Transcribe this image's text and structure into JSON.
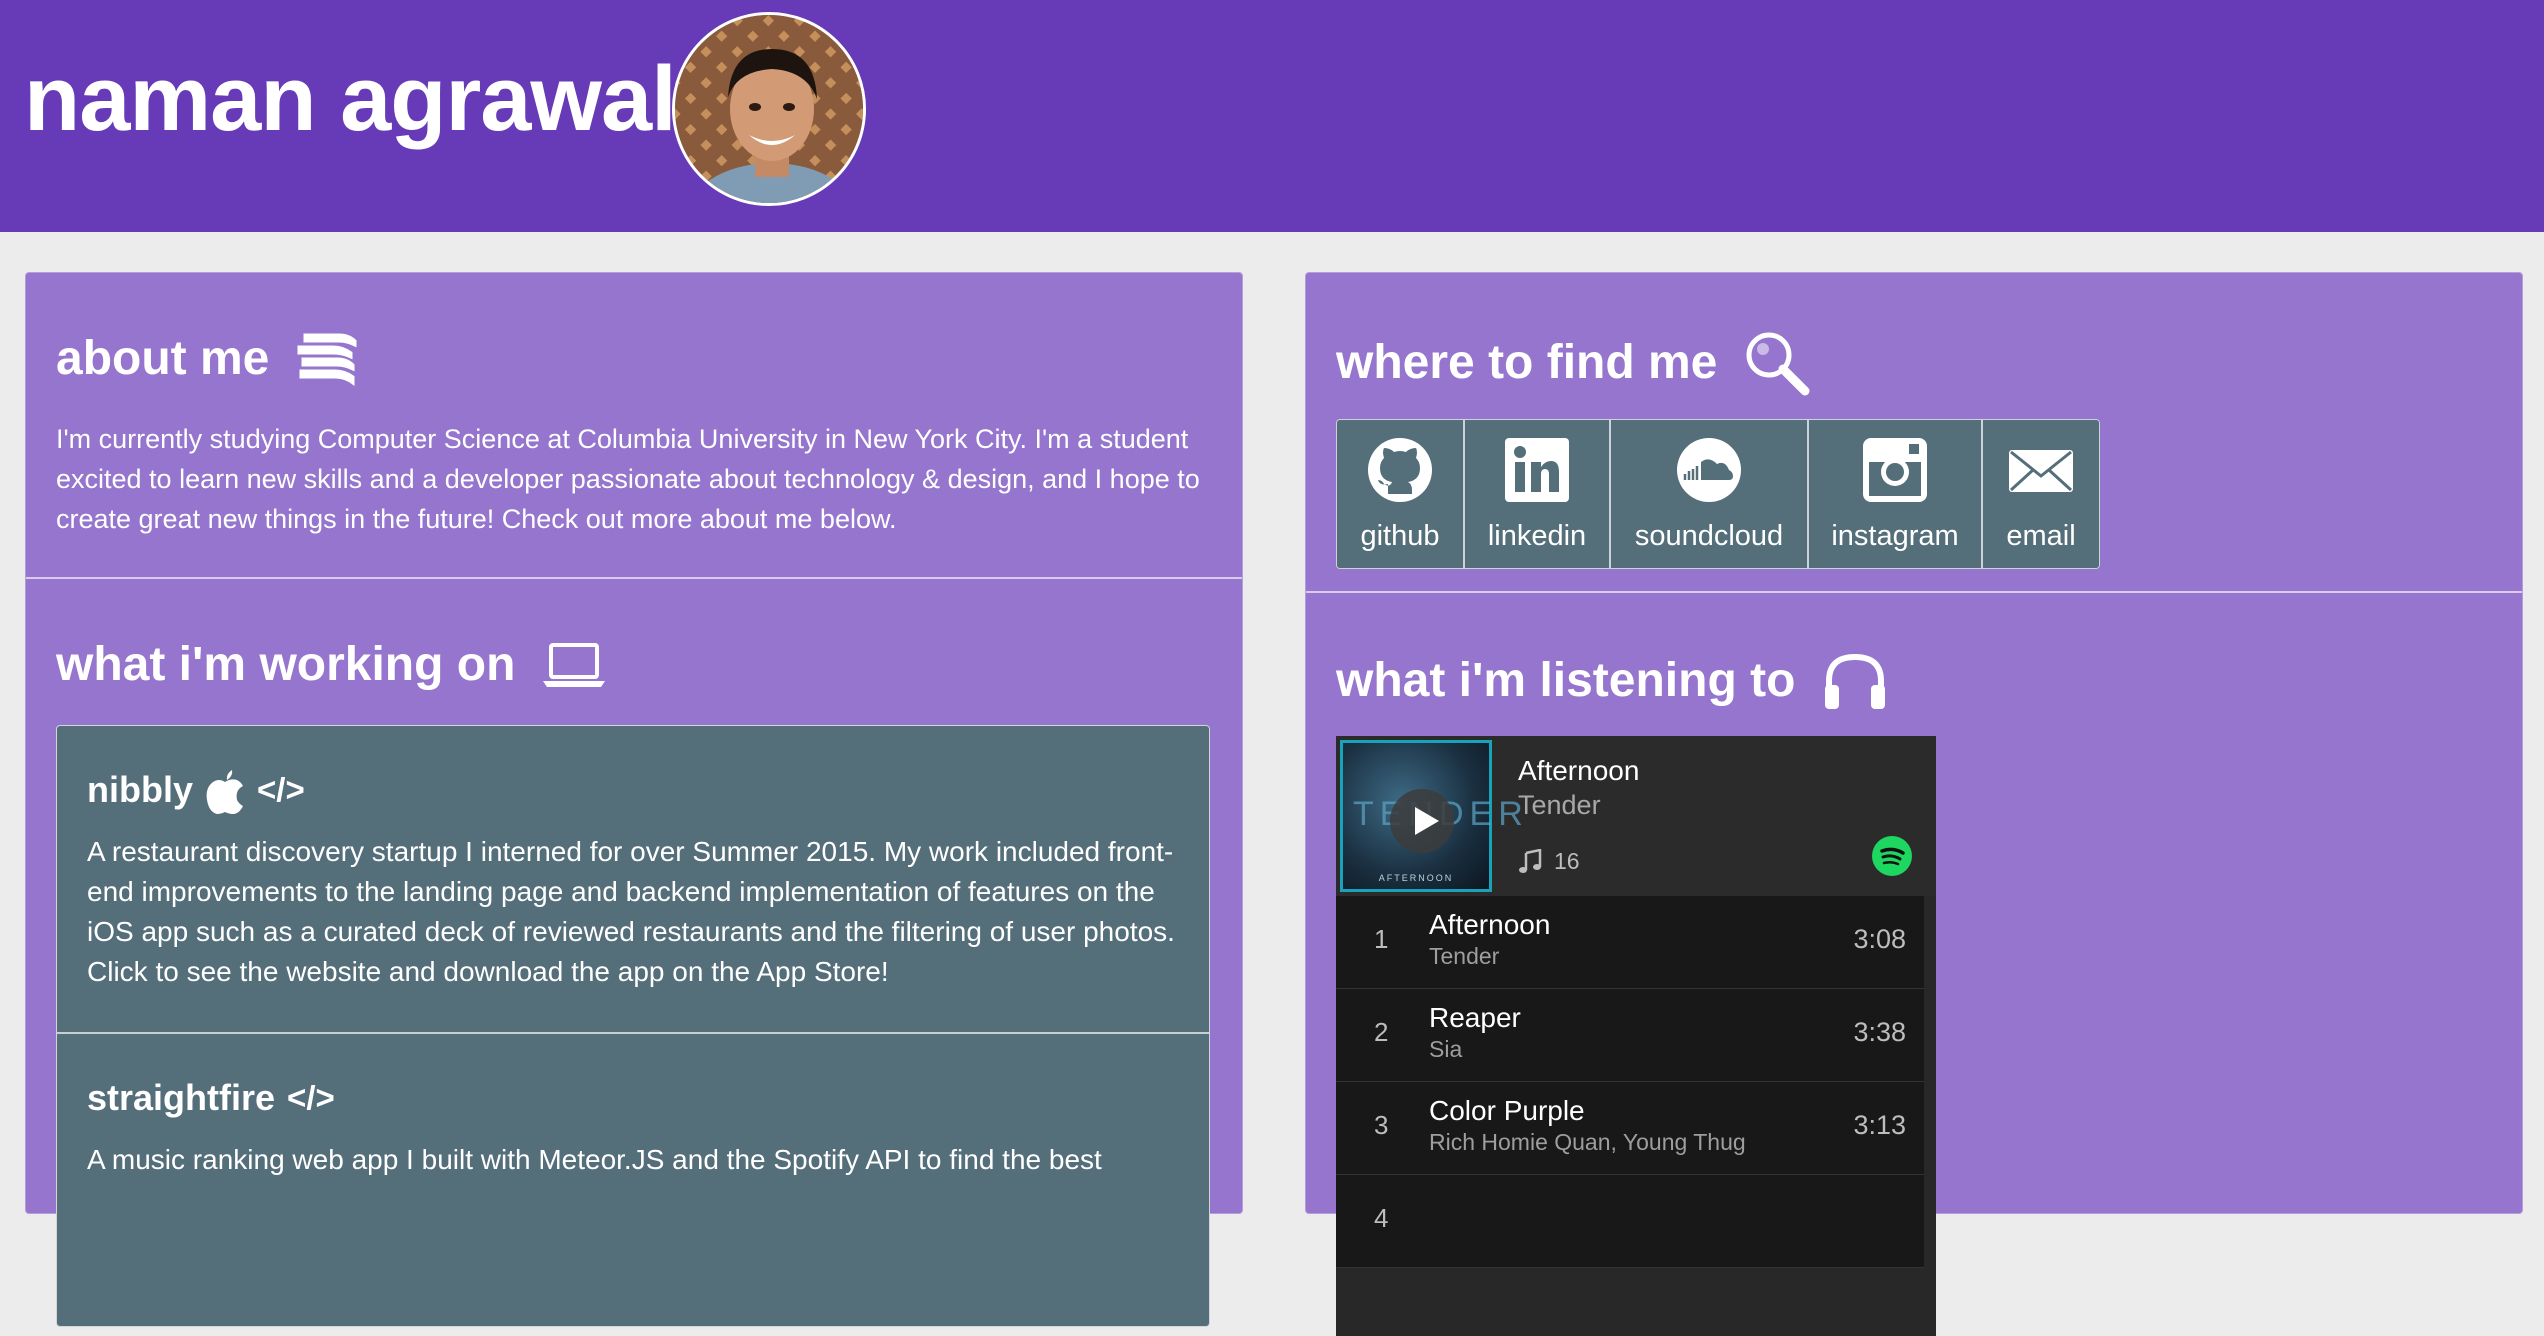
{
  "header": {
    "title": "naman agrawal"
  },
  "about": {
    "title": "about me",
    "text": "I'm currently studying Computer Science at Columbia University in New York City. I'm a student excited to learn new skills and a developer passionate about technology & design, and I hope to create great new things in the future! Check out more about me below."
  },
  "working": {
    "title": "what i'm working on",
    "projects": [
      {
        "name": "nibbly",
        "code_icon": "</>",
        "description": "A restaurant discovery startup I interned for over Summer 2015. My work included front-end improvements to the landing page and backend implementation of features on the iOS app such as a curated deck of reviewed restaurants and the filtering of user photos. Click to see the website and download the app on the App Store!"
      },
      {
        "name": "straightfire",
        "code_icon": "</>",
        "description": "A music ranking web app I built with Meteor.JS and the Spotify API to find the best"
      }
    ]
  },
  "find": {
    "title": "where to find me",
    "links": [
      {
        "label": "github",
        "icon": "github-icon"
      },
      {
        "label": "linkedin",
        "icon": "linkedin-icon"
      },
      {
        "label": "soundcloud",
        "icon": "soundcloud-icon"
      },
      {
        "label": "instagram",
        "icon": "instagram-icon"
      },
      {
        "label": "email",
        "icon": "email-icon"
      }
    ]
  },
  "listening": {
    "title": "what i'm listening to",
    "player": {
      "album_title": "Afternoon",
      "album_artist": "Tender",
      "cover_word": "TENDER",
      "cover_caption": "AFTERNOON",
      "track_count": "16",
      "tracks": [
        {
          "num": "1",
          "name": "Afternoon",
          "artist": "Tender",
          "duration": "3:08"
        },
        {
          "num": "2",
          "name": "Reaper",
          "artist": "Sia",
          "duration": "3:38"
        },
        {
          "num": "3",
          "name": "Color Purple",
          "artist": "Rich Homie Quan, Young Thug",
          "duration": "3:13"
        },
        {
          "num": "4",
          "name": "",
          "artist": "",
          "duration": ""
        }
      ]
    }
  },
  "colors": {
    "header": "#673ab7",
    "panel": "#9575cd",
    "card": "#546e7a",
    "spotify_green": "#1ed760",
    "page_background": "#ececec"
  }
}
